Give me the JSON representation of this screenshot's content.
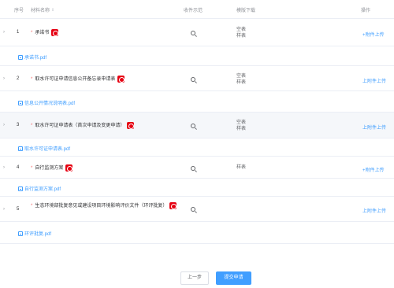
{
  "header": {
    "col_index": "序号",
    "col_name": "材料名称",
    "col_sample": "收件示范",
    "col_template": "模版下载",
    "col_action": "操作"
  },
  "rows": [
    {
      "index": "1",
      "name": "承诺书",
      "templates": [
        "空表",
        "样表"
      ],
      "action": "+附件上传",
      "file": "承诺书.pdf"
    },
    {
      "index": "2",
      "name": "取水许可证申请信息公开备忘录申请表",
      "templates": [
        "空表",
        "样表"
      ],
      "action": "上附件上传",
      "file": "信息公开情况说明表.pdf"
    },
    {
      "index": "3",
      "name": "取水许可证申请表（首次申请及变更申请）",
      "templates": [
        "空表",
        "样表"
      ],
      "action": "上附件上传",
      "file": "取水许可证申请表.pdf"
    },
    {
      "index": "4",
      "name": "自行监测方案",
      "templates": [
        "样表"
      ],
      "action": "+附件上传",
      "file": "自行监测方案.pdf"
    },
    {
      "index": "5",
      "name": "生态环境部批复意见或建设项目环境影响评价文件（环评批复）",
      "templates": [],
      "action": "上附件上传",
      "file": "环评批复.pdf"
    }
  ],
  "buttons": {
    "prev": "上一步",
    "submit": "提交申请"
  },
  "icons": {
    "expand": "chevron-right-icon",
    "sort": "sort-icon",
    "badge": "red-badge-icon",
    "sample": "search-icon",
    "file": "file-icon"
  },
  "colors": {
    "accent": "#409eff",
    "required": "#f56c6c",
    "badge": "#e60012",
    "alt_row": "#f5f7fa"
  }
}
